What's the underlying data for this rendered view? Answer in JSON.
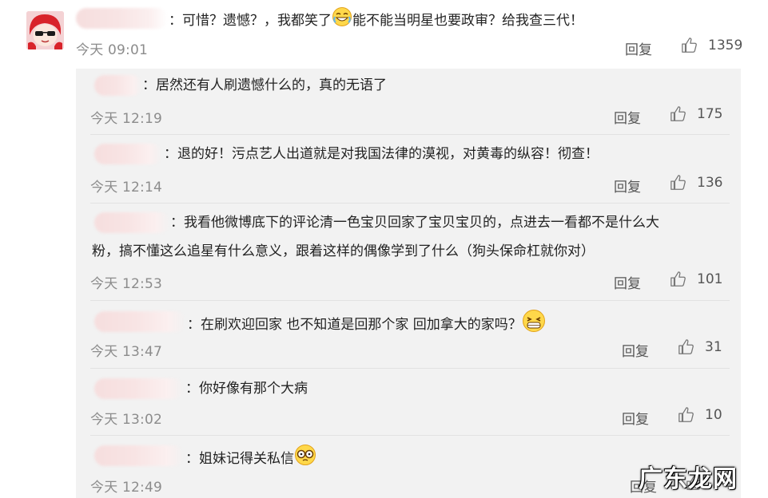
{
  "main": {
    "text": "：可惜？遗憾？，我都笑了",
    "text_after_emoji": "能不能当明星也要政审？给我查三代！",
    "time": "今天 09:01",
    "reply_label": "回复",
    "likes": "1359"
  },
  "replies": [
    {
      "text": "：居然还有人刷遗憾什么的，真的无语了",
      "time": "今天 12:19",
      "reply_label": "回复",
      "likes": "175"
    },
    {
      "text": "：退的好！污点艺人出道就是对我国法律的漠视，对黄毒的纵容！彻查！",
      "time": "今天 12:14",
      "reply_label": "回复",
      "likes": "136"
    },
    {
      "text": "：我看他微博底下的评论清一色宝贝回家了宝贝宝贝的，点进去一看都不是什么大",
      "text_line2": "粉，搞不懂这么追星有什么意义，跟着这样的偶像学到了什么（狗头保命杠就你对）",
      "time": "今天 12:53",
      "reply_label": "回复",
      "likes": "101"
    },
    {
      "text": "：在刷欢迎回家 也不知道是回那个家 回加拿大的家吗？",
      "time": "今天 13:47",
      "reply_label": "回复",
      "likes": "31"
    },
    {
      "text": "：你好像有那个大病",
      "time": "今天 13:02",
      "reply_label": "回复",
      "likes": "10"
    },
    {
      "text": "：姐妹记得关私信",
      "time": "今天 12:49",
      "reply_label": "回复",
      "likes": ""
    }
  ],
  "watermark": "广东龙网",
  "icons": {
    "like": "thumbs-up-icon",
    "emoji": "laughing-emoji-icon"
  },
  "colors": {
    "reply_bg": "#f2f2f2",
    "time": "#8c8c8c",
    "text": "#222222"
  }
}
